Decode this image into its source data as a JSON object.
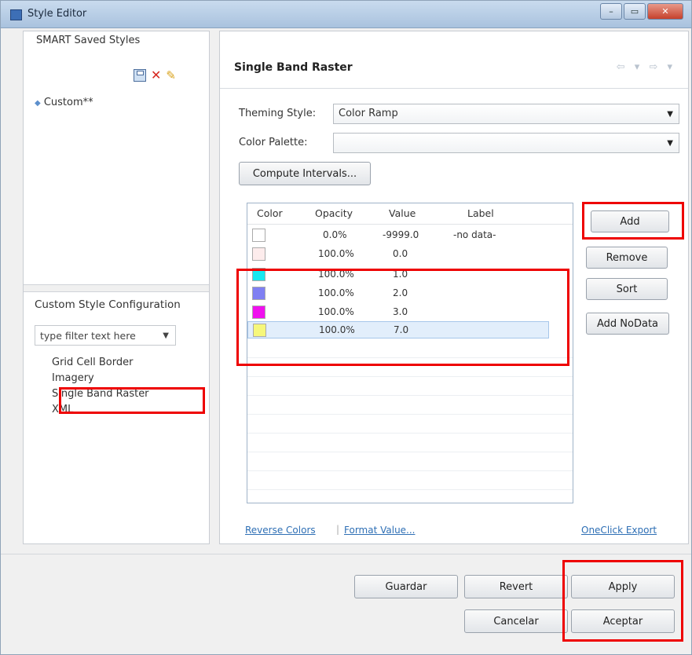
{
  "window": {
    "title": "Style Editor"
  },
  "left": {
    "saved_styles_header": "SMART Saved Styles",
    "custom_item": "Custom**",
    "config_title": "Custom Style Configuration",
    "filter_placeholder": "type filter text here",
    "config_items": [
      "Grid Cell Border",
      "Imagery",
      "Single Band Raster",
      "XML"
    ]
  },
  "right": {
    "title": "Single Band Raster",
    "theming_label": "Theming Style:",
    "theming_value": "Color Ramp",
    "palette_label": "Color Palette:",
    "palette_value": "",
    "compute_button": "Compute Intervals...",
    "columns": [
      "Color",
      "Opacity",
      "Value",
      "Label"
    ],
    "rows": [
      {
        "color": "#ffffff",
        "opacity": "0.0%",
        "value": "-9999.0",
        "label": "-no data-"
      },
      {
        "color": "#fdecec",
        "opacity": "100.0%",
        "value": "0.0",
        "label": ""
      },
      {
        "color": "#19e8f0",
        "opacity": "100.0%",
        "value": "1.0",
        "label": ""
      },
      {
        "color": "#7f7ff2",
        "opacity": "100.0%",
        "value": "2.0",
        "label": ""
      },
      {
        "color": "#f010ee",
        "opacity": "100.0%",
        "value": "3.0",
        "label": ""
      },
      {
        "color": "#f6f77a",
        "opacity": "100.0%",
        "value": "7.0",
        "label": ""
      }
    ],
    "side_buttons": [
      "Add",
      "Remove",
      "Sort",
      "Add NoData"
    ],
    "links": {
      "reverse": "Reverse Colors",
      "format": "Format Value...",
      "export": "OneClick Export"
    }
  },
  "footer": {
    "guardar": "Guardar",
    "revert": "Revert",
    "apply": "Apply",
    "cancelar": "Cancelar",
    "aceptar": "Aceptar"
  },
  "colors": {
    "highlight": "#ee0000"
  }
}
